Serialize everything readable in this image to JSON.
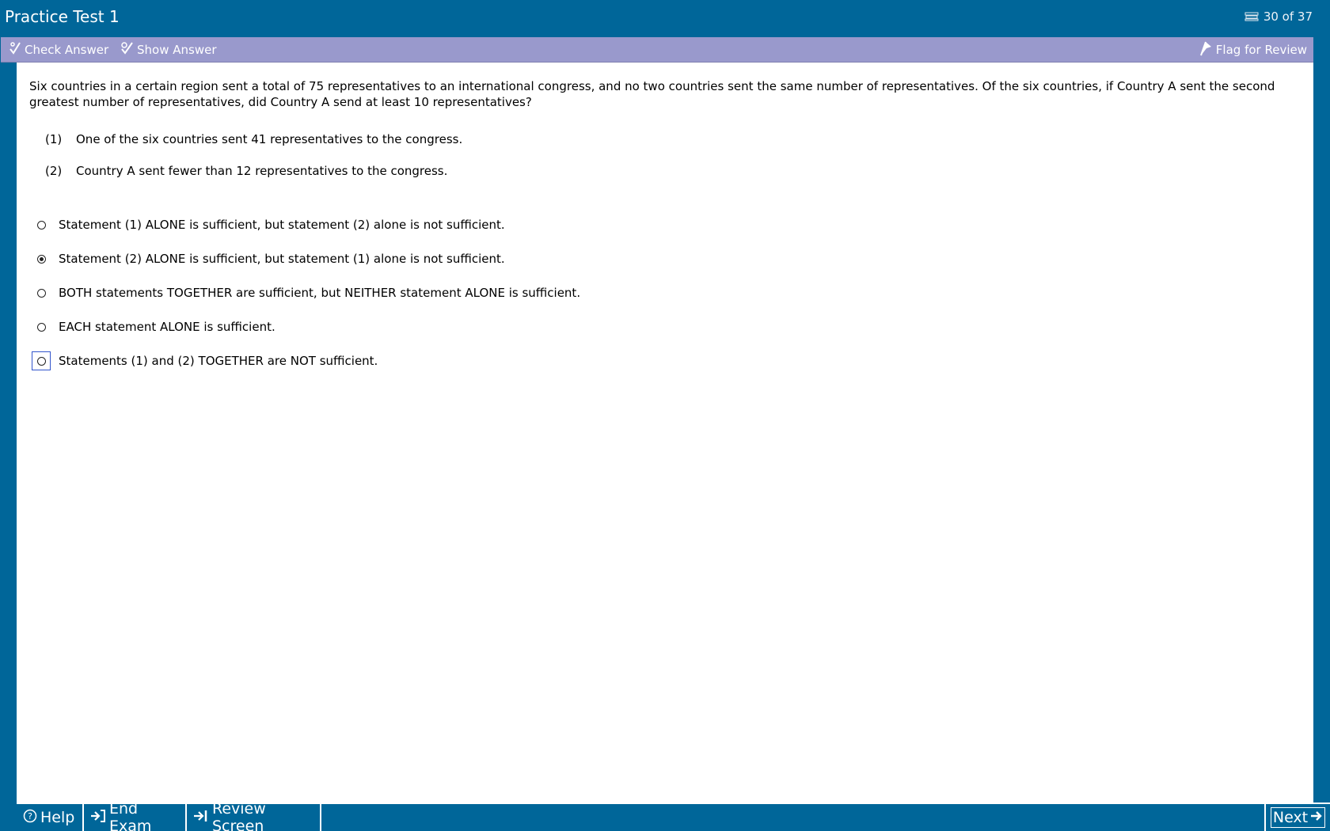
{
  "window": {
    "title": "Practice Test 1",
    "counter": "30 of 37"
  },
  "toolbar": {
    "check_answer": "Check Answer",
    "show_answer": "Show Answer",
    "flag_for_review": "Flag for Review"
  },
  "question": {
    "stem": "Six countries in a certain region sent a total of 75 representatives to an international congress, and no two countries sent the same number of representatives.  Of the six countries, if Country A sent the second greatest number of representatives, did Country A send at least 10 representatives?",
    "statements": [
      {
        "num": "(1)",
        "text": "One of the six countries sent 41 representatives to the congress."
      },
      {
        "num": "(2)",
        "text": "Country A sent fewer than 12 representatives to the congress."
      }
    ]
  },
  "options": [
    {
      "text": "Statement (1) ALONE is sufficient, but statement (2) alone is not sufficient.",
      "selected": false
    },
    {
      "text": "Statement (2) ALONE is sufficient, but statement (1) alone is not sufficient.",
      "selected": true
    },
    {
      "text": "BOTH statements TOGETHER are sufficient, but NEITHER statement ALONE is sufficient.",
      "selected": false
    },
    {
      "text": "EACH statement ALONE is sufficient.",
      "selected": false
    },
    {
      "text": "Statements (1) and (2) TOGETHER are NOT sufficient.",
      "selected": false
    }
  ],
  "bottombar": {
    "help": "Help",
    "end_exam": "End Exam",
    "review_screen": "Review Screen",
    "next": "Next"
  },
  "colors": {
    "frame": "#006699",
    "toolbar": "#9999cc",
    "content": "#ffffff"
  },
  "icons": {
    "counter": "stack-icon",
    "check": "check-answer-icon",
    "show": "show-answer-icon",
    "flag": "flag-icon",
    "help": "help-icon",
    "end": "end-exam-icon",
    "review": "review-screen-icon",
    "next": "arrow-right-icon"
  }
}
